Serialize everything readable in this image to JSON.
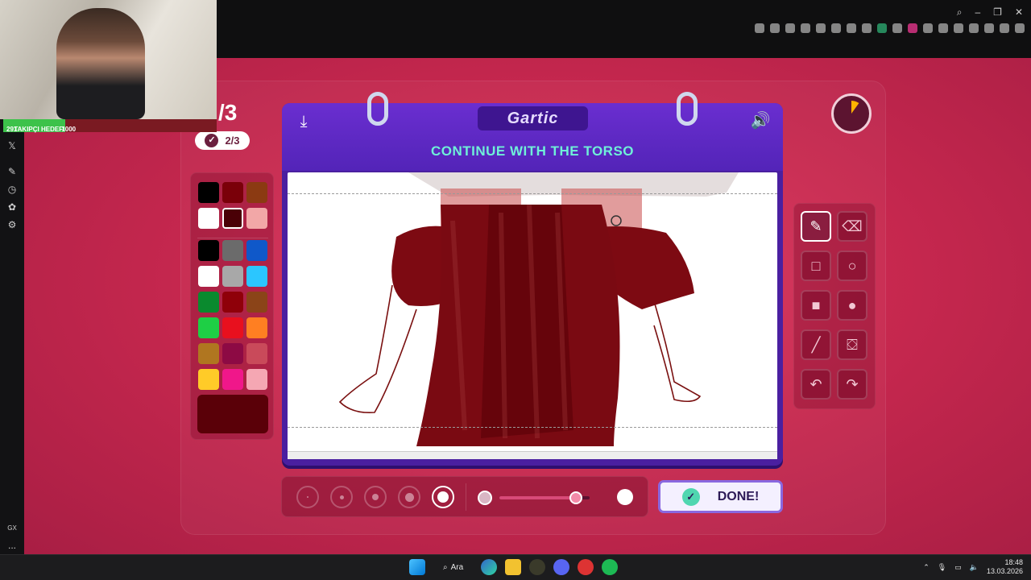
{
  "browser": {
    "sidebar_icons": [
      "x-icon",
      "wrench-icon",
      "clock-icon",
      "pet-icon",
      "gear-icon"
    ],
    "sidebar_bottom": [
      "GX",
      "..."
    ]
  },
  "stream_overlay": {
    "follow_goal": {
      "current": "291",
      "title": "TAKIPÇI HEDEFI",
      "goal": "1000",
      "progress": 0.291
    }
  },
  "round": {
    "big": "/3",
    "pill": "2/3"
  },
  "game": {
    "logo": "Gartic",
    "instruction": "CONTINUE WITH THE TORSO",
    "done_label": "DONE!",
    "current_color": "#5a0008",
    "palette_top": [
      "#000000",
      "#7a0009",
      "#8b3a12",
      "#ffffff",
      "#4a0006",
      "#f2a7a7"
    ],
    "palette": [
      "#000000",
      "#6b6b6b",
      "#0f58c9",
      "#ffffff",
      "#a8a8a8",
      "#2bc6ff",
      "#0a8a2e",
      "#8f0009",
      "#8b4418",
      "#1ecf45",
      "#e8101e",
      "#ff7f22",
      "#b07620",
      "#8d0a44",
      "#c94a5a",
      "#ffcb28",
      "#f0178a",
      "#f5a7b3"
    ],
    "selected_palette_top_index": 4,
    "tools": [
      "pencil-icon",
      "eraser-icon",
      "square-outline-icon",
      "circle-outline-icon",
      "square-filled-icon",
      "circle-filled-icon",
      "line-icon",
      "fill-bucket-icon",
      "undo-icon",
      "redo-icon"
    ],
    "active_tool": "pencil-icon",
    "brush_sizes": 5,
    "selected_brush_size_index": 4,
    "opacity_level": 0.85,
    "timer_elapsed_fraction": 0.1
  },
  "taskbar": {
    "search_label": "Ara",
    "time": "18:48",
    "date": "13.03.2026"
  }
}
